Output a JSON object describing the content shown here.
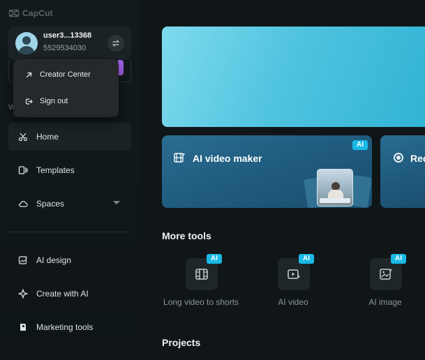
{
  "app": {
    "logo_text": "CapCut"
  },
  "account": {
    "username": "user3...13368",
    "user_id": "5529534030"
  },
  "account_menu": {
    "items": [
      {
        "label": "Creator Center",
        "icon": "external-arrow-icon"
      },
      {
        "label": "Sign out",
        "icon": "sign-out-icon"
      }
    ]
  },
  "sidebar": {
    "section_hint": "W",
    "items": [
      {
        "label": "Home",
        "icon": "scissors-icon",
        "active": true
      },
      {
        "label": "Templates",
        "icon": "templates-icon"
      },
      {
        "label": "Spaces",
        "icon": "cloud-icon"
      },
      {
        "label": "AI design",
        "icon": "ai-design-icon"
      },
      {
        "label": "Create with AI",
        "icon": "sparkle-icon"
      },
      {
        "label": "Marketing tools",
        "icon": "marketing-icon"
      }
    ]
  },
  "main": {
    "features": [
      {
        "title": "AI video maker",
        "badge": "AI"
      },
      {
        "title": "Rec"
      }
    ],
    "more_tools_title": "More tools",
    "tools": [
      {
        "label": "Long video to shorts",
        "badge": "AI",
        "icon": "film-split-icon"
      },
      {
        "label": "AI video",
        "badge": "AI",
        "icon": "video-sparkle-icon"
      },
      {
        "label": "AI image",
        "badge": "AI",
        "icon": "image-sparkle-icon"
      }
    ],
    "projects_title": "Projects"
  },
  "colors": {
    "background": "#101618",
    "accent_ai_badge": "#19b9e6",
    "hero_cyan": "#4fc3df",
    "feature_card_blue": "#1e587b",
    "upgrade_purple": "#a565f0"
  }
}
